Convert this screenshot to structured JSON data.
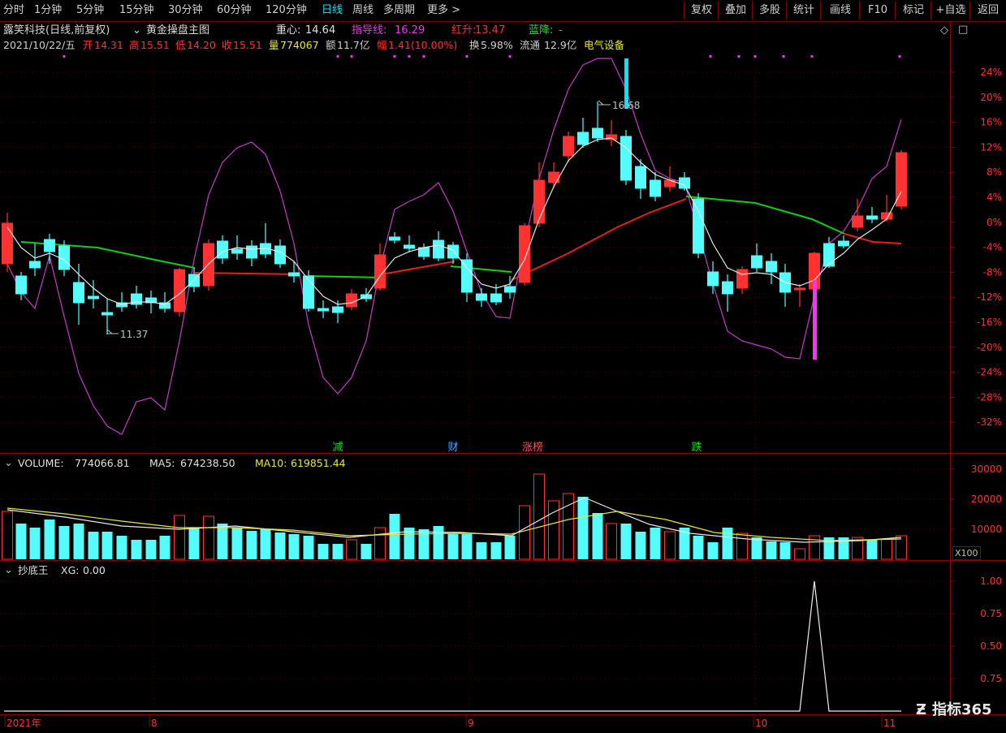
{
  "toolbar": {
    "left": [
      "分时",
      "1分钟",
      "5分钟",
      "15分钟",
      "30分钟",
      "60分钟",
      "120分钟",
      "日线",
      "周线",
      "多周期",
      "更多 >"
    ],
    "active": "日线",
    "right": [
      "复权",
      "叠加",
      "多股",
      "统计",
      "画线",
      "F10",
      "标记",
      "+自选",
      "返回"
    ]
  },
  "header": {
    "stock": "露笑科技(日线,前复权)",
    "indicator": "黄金操盘主图",
    "zhongxin_label": "重心:",
    "zhongxin_value": "14.64",
    "zhidao_label": "指导线:",
    "zhidao_value": "16.29",
    "hongsheng_label": "红升:",
    "hongsheng_value": "13.47",
    "lanjiang_label": "蓝降:",
    "lanjiang_value": "-",
    "date": "2021/10/22/五",
    "open_label": "开",
    "open": "14.31",
    "high_label": "高",
    "high": "15.51",
    "low_label": "低",
    "low": "14.20",
    "close_label": "收",
    "close": "15.51",
    "vol_label": "量",
    "vol": "774067",
    "amount_label": "额",
    "amount": "11.7亿",
    "amp_label": "幅",
    "amp": "1.41(10.00%)",
    "turnover_label": "换",
    "turnover": "5.98%",
    "float_label": "流通",
    "float": "12.9亿",
    "sector": "电气设备"
  },
  "main_panel": {
    "y_axis": [
      "24%",
      "20%",
      "16%",
      "12%",
      "8%",
      "4%",
      "0%",
      "-4%",
      "-8%",
      "-12%",
      "-16%",
      "-20%",
      "-24%",
      "-28%",
      "-32%"
    ],
    "annotation_low": "11.37",
    "annotation_high": "16.68",
    "tags": [
      {
        "text": "减",
        "color": "#00e000"
      },
      {
        "text": "财",
        "color": "#4fa8ff"
      },
      {
        "text": "涨榜",
        "color": "#ff5050"
      },
      {
        "text": "跌",
        "color": "#00e000"
      }
    ]
  },
  "volume_panel": {
    "label": "VOLUME:",
    "value": "774066.81",
    "ma5_label": "MA5:",
    "ma5": "674238.50",
    "ma10_label": "MA10:",
    "ma10": "619851.44",
    "y_axis": [
      "30000",
      "20000",
      "10000"
    ],
    "unit": "X100"
  },
  "xg_panel": {
    "label": "抄底王",
    "xg_label": "XG:",
    "xg_value": "0.00",
    "y_axis": [
      "1.00",
      "0.75",
      "0.50",
      "0.75"
    ]
  },
  "x_axis": [
    "2021年",
    "8",
    "9",
    "10",
    "11"
  ],
  "watermark": "指标365",
  "colors": {
    "up": "#ff3232",
    "down": "#54fcfc",
    "green_line": "#10d010",
    "red_line": "#e81e1e",
    "purple": "#c040c0",
    "accent": "#00e6ff"
  }
}
